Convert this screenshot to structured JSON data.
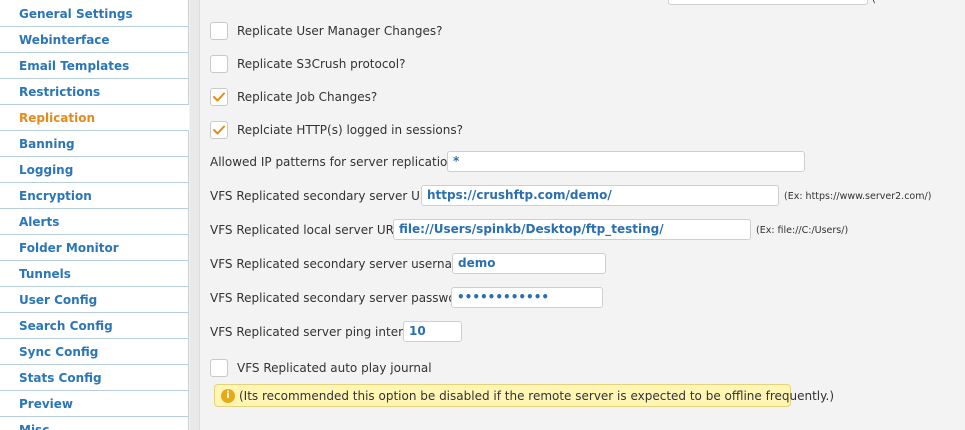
{
  "sidebar": {
    "items": [
      {
        "label": "General Settings"
      },
      {
        "label": "Webinterface"
      },
      {
        "label": "Email Templates"
      },
      {
        "label": "Restrictions"
      },
      {
        "label": "Replication",
        "active": true
      },
      {
        "label": "Banning"
      },
      {
        "label": "Logging"
      },
      {
        "label": "Encryption"
      },
      {
        "label": "Alerts"
      },
      {
        "label": "Folder Monitor"
      },
      {
        "label": "Tunnels"
      },
      {
        "label": "User Config"
      },
      {
        "label": "Search Config"
      },
      {
        "label": "Sync Config"
      },
      {
        "label": "Stats Config"
      },
      {
        "label": "Preview"
      },
      {
        "label": "Misc"
      }
    ]
  },
  "top": {
    "paren": "("
  },
  "options": {
    "replicate_user_manager": {
      "label": "Replicate User Manager Changes?",
      "checked": false
    },
    "replicate_s3crush": {
      "label": "Replicate S3Crush protocol?",
      "checked": false
    },
    "replicate_job_changes": {
      "label": "Replicate Job Changes?",
      "checked": true
    },
    "replicate_http_sessions": {
      "label": "Replciate HTTP(s) logged in sessions?",
      "checked": true
    }
  },
  "fields": {
    "allowed_ip": {
      "label": "Allowed IP patterns for server replication :",
      "value": "*"
    },
    "secondary_url": {
      "label": "VFS Replicated secondary server URL :",
      "value": "https://crushftp.com/demo/",
      "hint": "(Ex: https://www.server2.com/)"
    },
    "local_url": {
      "label": "VFS Replicated local server URL :",
      "value": "file://Users/spinkb/Desktop/ftp_testing/",
      "hint": "(Ex: file://C:/Users/)"
    },
    "secondary_username": {
      "label": "VFS Replicated secondary server username :",
      "value": "demo"
    },
    "secondary_password": {
      "label": "VFS Replicated secondary server password :",
      "value": "••••••••••••"
    },
    "ping_interval": {
      "label": "VFS Replicated server ping interval",
      "value": "10"
    }
  },
  "auto_play": {
    "label": "VFS Replicated auto play journal",
    "checked": false
  },
  "note": {
    "icon": "info-icon",
    "glyph": "i",
    "text": "(Its recommended this option be disabled if the remote server is expected to be offline frequently.)"
  },
  "colors": {
    "accent_link": "#2a76b8",
    "active_item": "#e88a1a",
    "checkmark": "#e88a1a",
    "note_bg": "#fff6b4"
  }
}
